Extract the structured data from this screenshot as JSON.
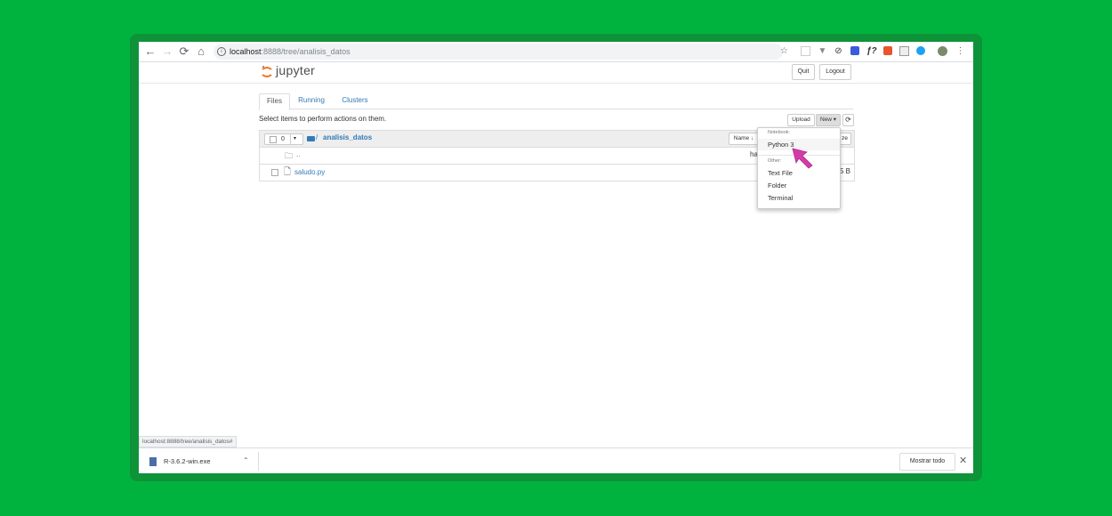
{
  "browser": {
    "url_host": "localhost",
    "url_path": ":8888/tree/analisis_datos"
  },
  "jupyter": {
    "logo_text": "jupyter",
    "quit_label": "Quit",
    "logout_label": "Logout"
  },
  "tabs": [
    {
      "label": "Files"
    },
    {
      "label": "Running"
    },
    {
      "label": "Clusters"
    }
  ],
  "files": {
    "hint": "Select items to perform actions on them.",
    "upload_label": "Upload",
    "new_label": "New ▾",
    "refresh_icon": "⟳",
    "selected_count": "0",
    "breadcrumb_sep": "/",
    "breadcrumb_dir": "analisis_datos",
    "name_sort_label": "Name ↓",
    "last_modified_partial": "ha",
    "size_partial": "ze",
    "parent_dir": "..",
    "rows": [
      {
        "name": "saludo.py",
        "size_partial": "5 B"
      }
    ]
  },
  "new_menu": {
    "notebook_header": "Notebook:",
    "python3": "Python 3",
    "other_header": "Other:",
    "text_file": "Text File",
    "folder": "Folder",
    "terminal": "Terminal"
  },
  "status_url": "localhost:8888/tree/analisis_datos#",
  "downloads": {
    "file_name": "R-3.6.2-win.exe",
    "show_all": "Mostrar todo"
  },
  "colors": {
    "background": "#00b33f",
    "link": "#337ab7",
    "cursor": "#d63aa8",
    "jupyter_orange": "#f37726"
  }
}
